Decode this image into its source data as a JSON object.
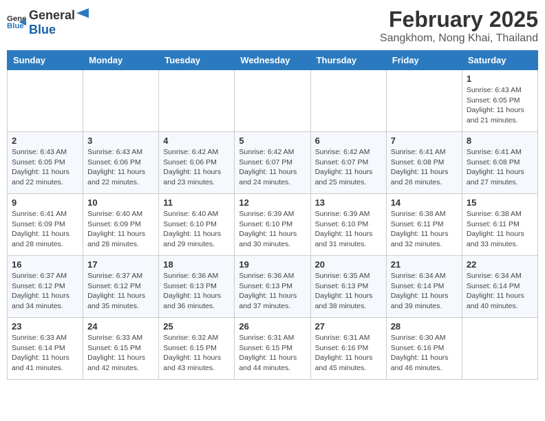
{
  "header": {
    "logo_general": "General",
    "logo_blue": "Blue",
    "month_title": "February 2025",
    "location": "Sangkhom, Nong Khai, Thailand"
  },
  "weekdays": [
    "Sunday",
    "Monday",
    "Tuesday",
    "Wednesday",
    "Thursday",
    "Friday",
    "Saturday"
  ],
  "weeks": [
    [
      {
        "day": "",
        "info": ""
      },
      {
        "day": "",
        "info": ""
      },
      {
        "day": "",
        "info": ""
      },
      {
        "day": "",
        "info": ""
      },
      {
        "day": "",
        "info": ""
      },
      {
        "day": "",
        "info": ""
      },
      {
        "day": "1",
        "info": "Sunrise: 6:43 AM\nSunset: 6:05 PM\nDaylight: 11 hours\nand 21 minutes."
      }
    ],
    [
      {
        "day": "2",
        "info": "Sunrise: 6:43 AM\nSunset: 6:05 PM\nDaylight: 11 hours\nand 22 minutes."
      },
      {
        "day": "3",
        "info": "Sunrise: 6:43 AM\nSunset: 6:06 PM\nDaylight: 11 hours\nand 22 minutes."
      },
      {
        "day": "4",
        "info": "Sunrise: 6:42 AM\nSunset: 6:06 PM\nDaylight: 11 hours\nand 23 minutes."
      },
      {
        "day": "5",
        "info": "Sunrise: 6:42 AM\nSunset: 6:07 PM\nDaylight: 11 hours\nand 24 minutes."
      },
      {
        "day": "6",
        "info": "Sunrise: 6:42 AM\nSunset: 6:07 PM\nDaylight: 11 hours\nand 25 minutes."
      },
      {
        "day": "7",
        "info": "Sunrise: 6:41 AM\nSunset: 6:08 PM\nDaylight: 11 hours\nand 26 minutes."
      },
      {
        "day": "8",
        "info": "Sunrise: 6:41 AM\nSunset: 6:08 PM\nDaylight: 11 hours\nand 27 minutes."
      }
    ],
    [
      {
        "day": "9",
        "info": "Sunrise: 6:41 AM\nSunset: 6:09 PM\nDaylight: 11 hours\nand 28 minutes."
      },
      {
        "day": "10",
        "info": "Sunrise: 6:40 AM\nSunset: 6:09 PM\nDaylight: 11 hours\nand 28 minutes."
      },
      {
        "day": "11",
        "info": "Sunrise: 6:40 AM\nSunset: 6:10 PM\nDaylight: 11 hours\nand 29 minutes."
      },
      {
        "day": "12",
        "info": "Sunrise: 6:39 AM\nSunset: 6:10 PM\nDaylight: 11 hours\nand 30 minutes."
      },
      {
        "day": "13",
        "info": "Sunrise: 6:39 AM\nSunset: 6:10 PM\nDaylight: 11 hours\nand 31 minutes."
      },
      {
        "day": "14",
        "info": "Sunrise: 6:38 AM\nSunset: 6:11 PM\nDaylight: 11 hours\nand 32 minutes."
      },
      {
        "day": "15",
        "info": "Sunrise: 6:38 AM\nSunset: 6:11 PM\nDaylight: 11 hours\nand 33 minutes."
      }
    ],
    [
      {
        "day": "16",
        "info": "Sunrise: 6:37 AM\nSunset: 6:12 PM\nDaylight: 11 hours\nand 34 minutes."
      },
      {
        "day": "17",
        "info": "Sunrise: 6:37 AM\nSunset: 6:12 PM\nDaylight: 11 hours\nand 35 minutes."
      },
      {
        "day": "18",
        "info": "Sunrise: 6:36 AM\nSunset: 6:13 PM\nDaylight: 11 hours\nand 36 minutes."
      },
      {
        "day": "19",
        "info": "Sunrise: 6:36 AM\nSunset: 6:13 PM\nDaylight: 11 hours\nand 37 minutes."
      },
      {
        "day": "20",
        "info": "Sunrise: 6:35 AM\nSunset: 6:13 PM\nDaylight: 11 hours\nand 38 minutes."
      },
      {
        "day": "21",
        "info": "Sunrise: 6:34 AM\nSunset: 6:14 PM\nDaylight: 11 hours\nand 39 minutes."
      },
      {
        "day": "22",
        "info": "Sunrise: 6:34 AM\nSunset: 6:14 PM\nDaylight: 11 hours\nand 40 minutes."
      }
    ],
    [
      {
        "day": "23",
        "info": "Sunrise: 6:33 AM\nSunset: 6:14 PM\nDaylight: 11 hours\nand 41 minutes."
      },
      {
        "day": "24",
        "info": "Sunrise: 6:33 AM\nSunset: 6:15 PM\nDaylight: 11 hours\nand 42 minutes."
      },
      {
        "day": "25",
        "info": "Sunrise: 6:32 AM\nSunset: 6:15 PM\nDaylight: 11 hours\nand 43 minutes."
      },
      {
        "day": "26",
        "info": "Sunrise: 6:31 AM\nSunset: 6:15 PM\nDaylight: 11 hours\nand 44 minutes."
      },
      {
        "day": "27",
        "info": "Sunrise: 6:31 AM\nSunset: 6:16 PM\nDaylight: 11 hours\nand 45 minutes."
      },
      {
        "day": "28",
        "info": "Sunrise: 6:30 AM\nSunset: 6:16 PM\nDaylight: 11 hours\nand 46 minutes."
      },
      {
        "day": "",
        "info": ""
      }
    ]
  ]
}
